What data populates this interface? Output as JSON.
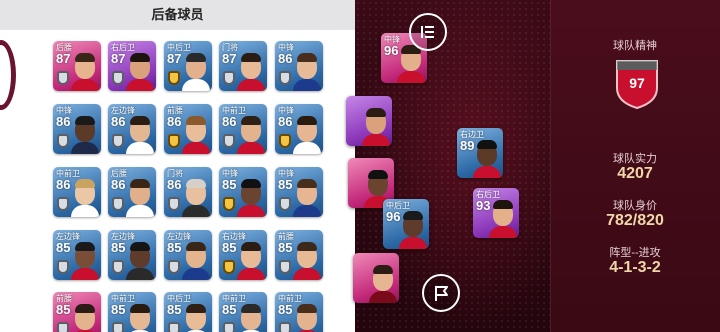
{
  "reserve": {
    "title": "后备球员",
    "cards": [
      {
        "pos": "后腰",
        "rating": "87",
        "color": "pink",
        "badge": "silver",
        "skin": "#e6b48f",
        "hair": "#3a2616",
        "shirt": "#c8102e"
      },
      {
        "pos": "右后卫",
        "rating": "87",
        "color": "purple",
        "badge": "silver",
        "skin": "#d9a27c",
        "hair": "#1e140e",
        "shirt": "#c8102e"
      },
      {
        "pos": "中后卫",
        "rating": "87",
        "color": "blue",
        "badge": "gold",
        "skin": "#e2b08c",
        "hair": "#2a2a2a",
        "shirt": "#ffffff"
      },
      {
        "pos": "门将",
        "rating": "87",
        "color": "blue",
        "badge": "silver",
        "skin": "#e8b996",
        "hair": "#2b1d14",
        "shirt": "#c8102e"
      },
      {
        "pos": "中锋",
        "rating": "86",
        "color": "blue",
        "badge": "silver",
        "skin": "#e7bb98",
        "hair": "#4a2e1c",
        "shirt": "#1d3b8c"
      },
      {
        "pos": "中锋",
        "rating": "86",
        "color": "blue",
        "badge": "silver",
        "skin": "#5b3a28",
        "hair": "#1a1a1a",
        "shirt": "#1e2a4a"
      },
      {
        "pos": "左边锋",
        "rating": "86",
        "color": "blue",
        "badge": "silver",
        "skin": "#e3b791",
        "hair": "#2b1d14",
        "shirt": "#ffffff"
      },
      {
        "pos": "前腰",
        "rating": "86",
        "color": "blue",
        "badge": "gold",
        "skin": "#e9bd9a",
        "hair": "#8a5a2e",
        "shirt": "#c8102e"
      },
      {
        "pos": "中前卫",
        "rating": "86",
        "color": "blue",
        "badge": "silver",
        "skin": "#e3b38e",
        "hair": "#2f1f14",
        "shirt": "#c8102e"
      },
      {
        "pos": "中锋",
        "rating": "86",
        "color": "blue",
        "badge": "gold",
        "skin": "#e6b591",
        "hair": "#2a1b10",
        "shirt": "#ffffff"
      },
      {
        "pos": "中前卫",
        "rating": "86",
        "color": "blue",
        "badge": "silver",
        "skin": "#ecc7a6",
        "hair": "#c9a35f",
        "shirt": "#ffffff"
      },
      {
        "pos": "后腰",
        "rating": "86",
        "color": "blue",
        "badge": "silver",
        "skin": "#e1b08a",
        "hair": "#3b2616",
        "shirt": "#ffffff"
      },
      {
        "pos": "门将",
        "rating": "86",
        "color": "blue",
        "badge": "silver",
        "skin": "#e8bf9f",
        "hair": "#d8d0c8",
        "shirt": "#2b2b2b"
      },
      {
        "pos": "中锋",
        "rating": "85",
        "color": "blue",
        "badge": "gold",
        "skin": "#6a4430",
        "hair": "#111111",
        "shirt": "#c8102e"
      },
      {
        "pos": "中锋",
        "rating": "85",
        "color": "blue",
        "badge": "silver",
        "skin": "#e6b692",
        "hair": "#4a2e1c",
        "shirt": "#1e3a8a"
      },
      {
        "pos": "左边锋",
        "rating": "85",
        "color": "blue",
        "badge": "silver",
        "skin": "#7a4e36",
        "hair": "#1a1a1a",
        "shirt": "#c8102e"
      },
      {
        "pos": "左边锋",
        "rating": "85",
        "color": "blue",
        "badge": "silver",
        "skin": "#5e3b2a",
        "hair": "#151515",
        "shirt": "#2a2a2a"
      },
      {
        "pos": "左边锋",
        "rating": "85",
        "color": "blue",
        "badge": "silver",
        "skin": "#e4b48f",
        "hair": "#3a2616",
        "shirt": "#1d3b8c"
      },
      {
        "pos": "右边锋",
        "rating": "85",
        "color": "blue",
        "badge": "gold",
        "skin": "#e8ba96",
        "hair": "#2b1d14",
        "shirt": "#c8102e"
      },
      {
        "pos": "前腰",
        "rating": "85",
        "color": "blue",
        "badge": "silver",
        "skin": "#e7b995",
        "hair": "#3b2a1c",
        "shirt": "#c8102e"
      },
      {
        "pos": "前腰",
        "rating": "85",
        "color": "pink",
        "badge": "silver",
        "skin": "#e3b38e",
        "hair": "#2b1d14",
        "shirt": "#c8102e"
      },
      {
        "pos": "中前卫",
        "rating": "85",
        "color": "blue",
        "badge": "silver",
        "skin": "#e6b793",
        "hair": "#2a1b10",
        "shirt": "#ffffff"
      },
      {
        "pos": "中后卫",
        "rating": "85",
        "color": "blue",
        "badge": "silver",
        "skin": "#e9bc98",
        "hair": "#2f1f14",
        "shirt": "#ffffff"
      },
      {
        "pos": "中前卫",
        "rating": "85",
        "color": "blue",
        "badge": "silver",
        "skin": "#e5b591",
        "hair": "#2a2a2a",
        "shirt": "#ffffff"
      },
      {
        "pos": "中前卫",
        "rating": "85",
        "color": "blue",
        "badge": "silver",
        "skin": "#e3b38f",
        "hair": "#4a2e1c",
        "shirt": "#c8102e"
      }
    ]
  },
  "pitch": {
    "cards": [
      {
        "pos": "中锋",
        "rating": "96",
        "color": "pink",
        "skin": "#e2b08a",
        "hair": "#2b1d14",
        "shirt": "#c8102e"
      },
      {
        "pos": "",
        "rating": "",
        "color": "purple",
        "skin": "#d9a27c",
        "hair": "#2b1d14",
        "shirt": "#c8102e"
      },
      {
        "pos": "右边卫",
        "rating": "89",
        "color": "blue",
        "skin": "#5b3a28",
        "hair": "#111111",
        "shirt": "#c8102e"
      },
      {
        "pos": "",
        "rating": "",
        "color": "pink",
        "skin": "#6b4430",
        "hair": "#111111",
        "shirt": "#c8102e"
      },
      {
        "pos": "中后卫",
        "rating": "96",
        "color": "blue",
        "skin": "#5e3b2a",
        "hair": "#1a1a1a",
        "shirt": "#c8102e"
      },
      {
        "pos": "右后卫",
        "rating": "93",
        "color": "purple",
        "skin": "#e3b08a",
        "hair": "#1e140e",
        "shirt": "#c8102e"
      },
      {
        "pos": "",
        "rating": "",
        "color": "pink",
        "skin": "#e6b692",
        "hair": "#2b1d14",
        "shirt": "#7a0a1a"
      }
    ]
  },
  "buttons": {
    "menu": "list-menu-icon",
    "flag": "flag-icon"
  },
  "team": {
    "spirit_label": "球队精神",
    "spirit_value": "97",
    "strength_label": "球队实力",
    "strength_value": "4207",
    "value_label": "球队身价",
    "value_value": "782/820",
    "formation_label": "阵型--进攻",
    "formation_value": "4-1-3-2"
  },
  "colors": {
    "panel_bg": "#ffffff",
    "header_bg": "#e4e4e6",
    "pitch_bg": "#2b0710",
    "stats_bg": "#4a0d1c",
    "gold_text": "#f0d7a9",
    "shield_red": "#c8102e"
  }
}
